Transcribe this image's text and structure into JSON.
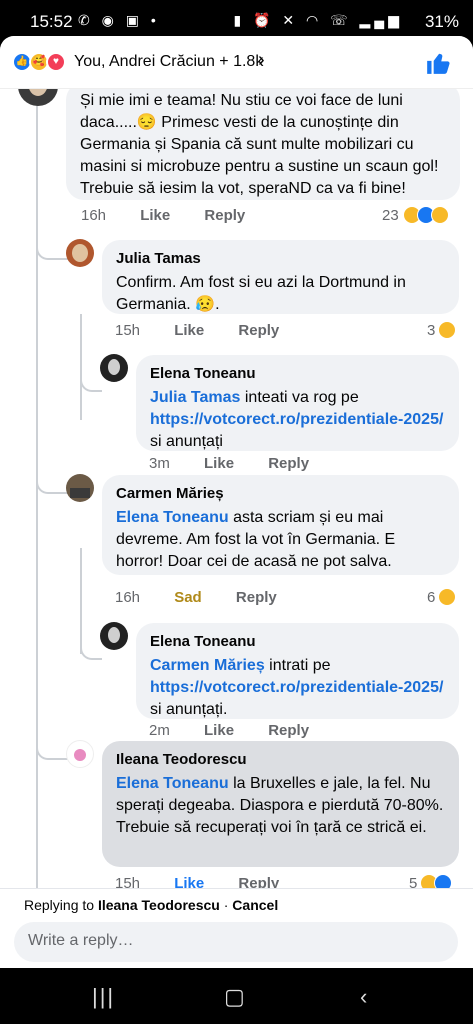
{
  "status_bar": {
    "time": "15:52",
    "battery": "31%"
  },
  "header": {
    "reactors": "You, Andrei Crăciun + 1.8k"
  },
  "comments": [
    {
      "text": "Și mie imi e teama! Nu stiu ce voi face de luni daca.....😔 Primesc vesti de la cunoștințe din Germania și Spania că sunt multe mobilizari cu masini si microbuze pentru a sustine un scaun gol! Trebuie să iesim la vot, speraND ca va fi bine!",
      "time": "16h",
      "like": "Like",
      "reply": "Reply",
      "count": "23"
    },
    {
      "name": "Julia Tamas",
      "text": "Confirm. Am fost si eu azi la Dortmund in Germania. 😥.",
      "time": "15h",
      "like": "Like",
      "reply": "Reply",
      "count": "3"
    },
    {
      "name": "Elena Toneanu",
      "mention": "Julia Tamas",
      "text_before": "inteati va rog pe",
      "link": "https://votcorect.ro/prezidentiale-2025/",
      "text_after": "si anunțați",
      "time": "3m",
      "like": "Like",
      "reply": "Reply"
    },
    {
      "name": "Carmen Mărieș",
      "mention": "Elena Toneanu",
      "text": "asta scriam și eu mai devreme. Am fost la vot în Germania. E horror! Doar cei de acasă ne pot salva.",
      "time": "16h",
      "like": "Sad",
      "reply": "Reply",
      "count": "6"
    },
    {
      "name": "Elena Toneanu",
      "mention": "Carmen Mărieș",
      "text_before": "intrati pe",
      "link": "https://votcorect.ro/prezidentiale-2025/",
      "text_after": "si anunțați.",
      "time": "2m",
      "like": "Like",
      "reply": "Reply"
    },
    {
      "name": "Ileana Teodorescu",
      "mention": "Elena Toneanu",
      "text": "la Bruxelles e jale, la fel. Nu sperați degeaba. Diaspora e pierdută 70-80%. Trebuie să recuperați voi în țară ce strică ei.",
      "time": "15h",
      "like": "Like",
      "reply": "Reply",
      "count": "5"
    }
  ],
  "composer": {
    "replying_prefix": "Replying to",
    "replying_name": "Ileana Teodorescu",
    "separator": " · ",
    "cancel": "Cancel",
    "placeholder": "Write a reply…"
  },
  "colors": {
    "link": "#1a6ed8",
    "like_active": "#1877f2",
    "sad": "#b08a1a",
    "bubble": "#f0f2f5"
  }
}
